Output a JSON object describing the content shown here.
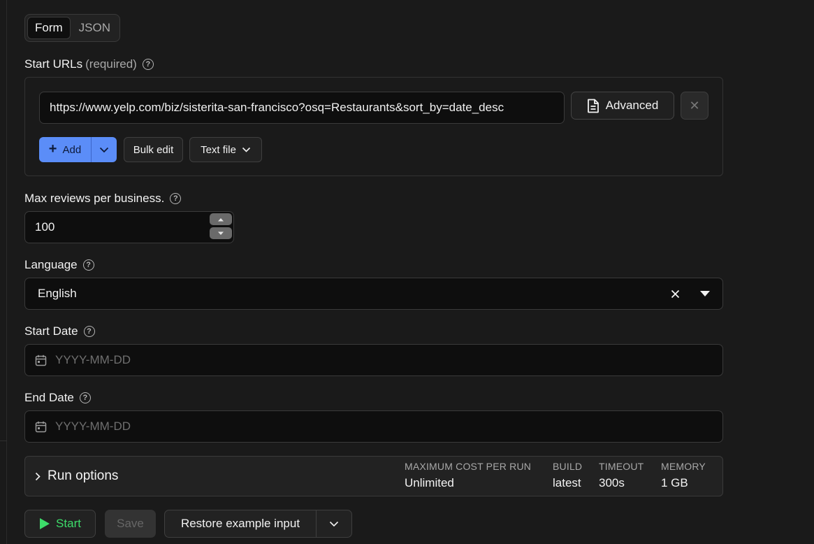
{
  "tabs": [
    {
      "label": "Form",
      "active": true
    },
    {
      "label": "JSON",
      "active": false
    }
  ],
  "start_urls": {
    "label": "Start URLs",
    "required_note": "(required)",
    "url_value": "https://www.yelp.com/biz/sisterita-san-francisco?osq=Restaurants&sort_by=date_desc",
    "advanced_label": "Advanced",
    "add_label": "Add",
    "bulk_edit_label": "Bulk edit",
    "text_file_label": "Text file"
  },
  "max_reviews": {
    "label": "Max reviews per business.",
    "value": "100"
  },
  "language": {
    "label": "Language",
    "value": "English"
  },
  "start_date": {
    "label": "Start Date",
    "placeholder": "YYYY-MM-DD"
  },
  "end_date": {
    "label": "End Date",
    "placeholder": "YYYY-MM-DD"
  },
  "run_options": {
    "title": "Run options",
    "stats": [
      {
        "key": "MAXIMUM COST PER RUN",
        "value": "Unlimited"
      },
      {
        "key": "BUILD",
        "value": "latest"
      },
      {
        "key": "TIMEOUT",
        "value": "300s"
      },
      {
        "key": "MEMORY",
        "value": "1 GB"
      }
    ]
  },
  "actions": {
    "start_label": "Start",
    "save_label": "Save",
    "restore_label": "Restore example input"
  },
  "colors": {
    "accent_blue": "#5b8df8",
    "start_green": "#3ddc6a",
    "background": "#1a1a1a"
  }
}
